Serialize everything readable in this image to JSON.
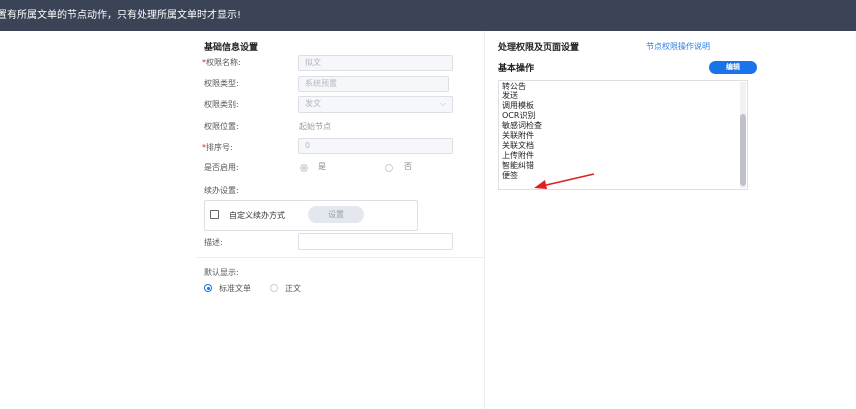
{
  "banner": {
    "text": "置有所属文单的节点动作，只有处理所属文单时才显示!"
  },
  "basic_info": {
    "title": "基础信息设置",
    "required_mark": "*",
    "fields": {
      "name": {
        "label": "权限名称:",
        "value": "拟文"
      },
      "type": {
        "label": "权限类型:",
        "value": "系统预置"
      },
      "category": {
        "label": "权限类别:",
        "value": "发文",
        "chevron": "⌵"
      },
      "position": {
        "label": "权限位置:",
        "value": "起始节点"
      },
      "sort": {
        "label": "排序号:",
        "value": "0"
      },
      "enabled": {
        "label": "是否启用:",
        "options": [
          "是",
          "否"
        ],
        "selected": "是"
      }
    },
    "follow_up": {
      "label": "续办设置:",
      "checkbox_label": "自定义续办方式",
      "button": "设置",
      "checked": false
    },
    "description": {
      "label": "描述:",
      "value": ""
    }
  },
  "default_display": {
    "label": "默认显示:",
    "options": [
      "标准文单",
      "正文"
    ],
    "selected": "标准文单"
  },
  "permissions": {
    "title": "处理权限及页面设置",
    "help_link": "节点权限操作说明",
    "basic_ops_title": "基本操作",
    "edit_button": "编辑",
    "items": [
      "转公告",
      "发送",
      "调用模板",
      "OCR识别",
      "敏感词检查",
      "关联附件",
      "关联文档",
      "上传附件",
      "智能纠错",
      "便签"
    ]
  },
  "colors": {
    "accent": "#1a73e8",
    "topbar": "#3a4456",
    "annotation_arrow": "#e02020"
  }
}
